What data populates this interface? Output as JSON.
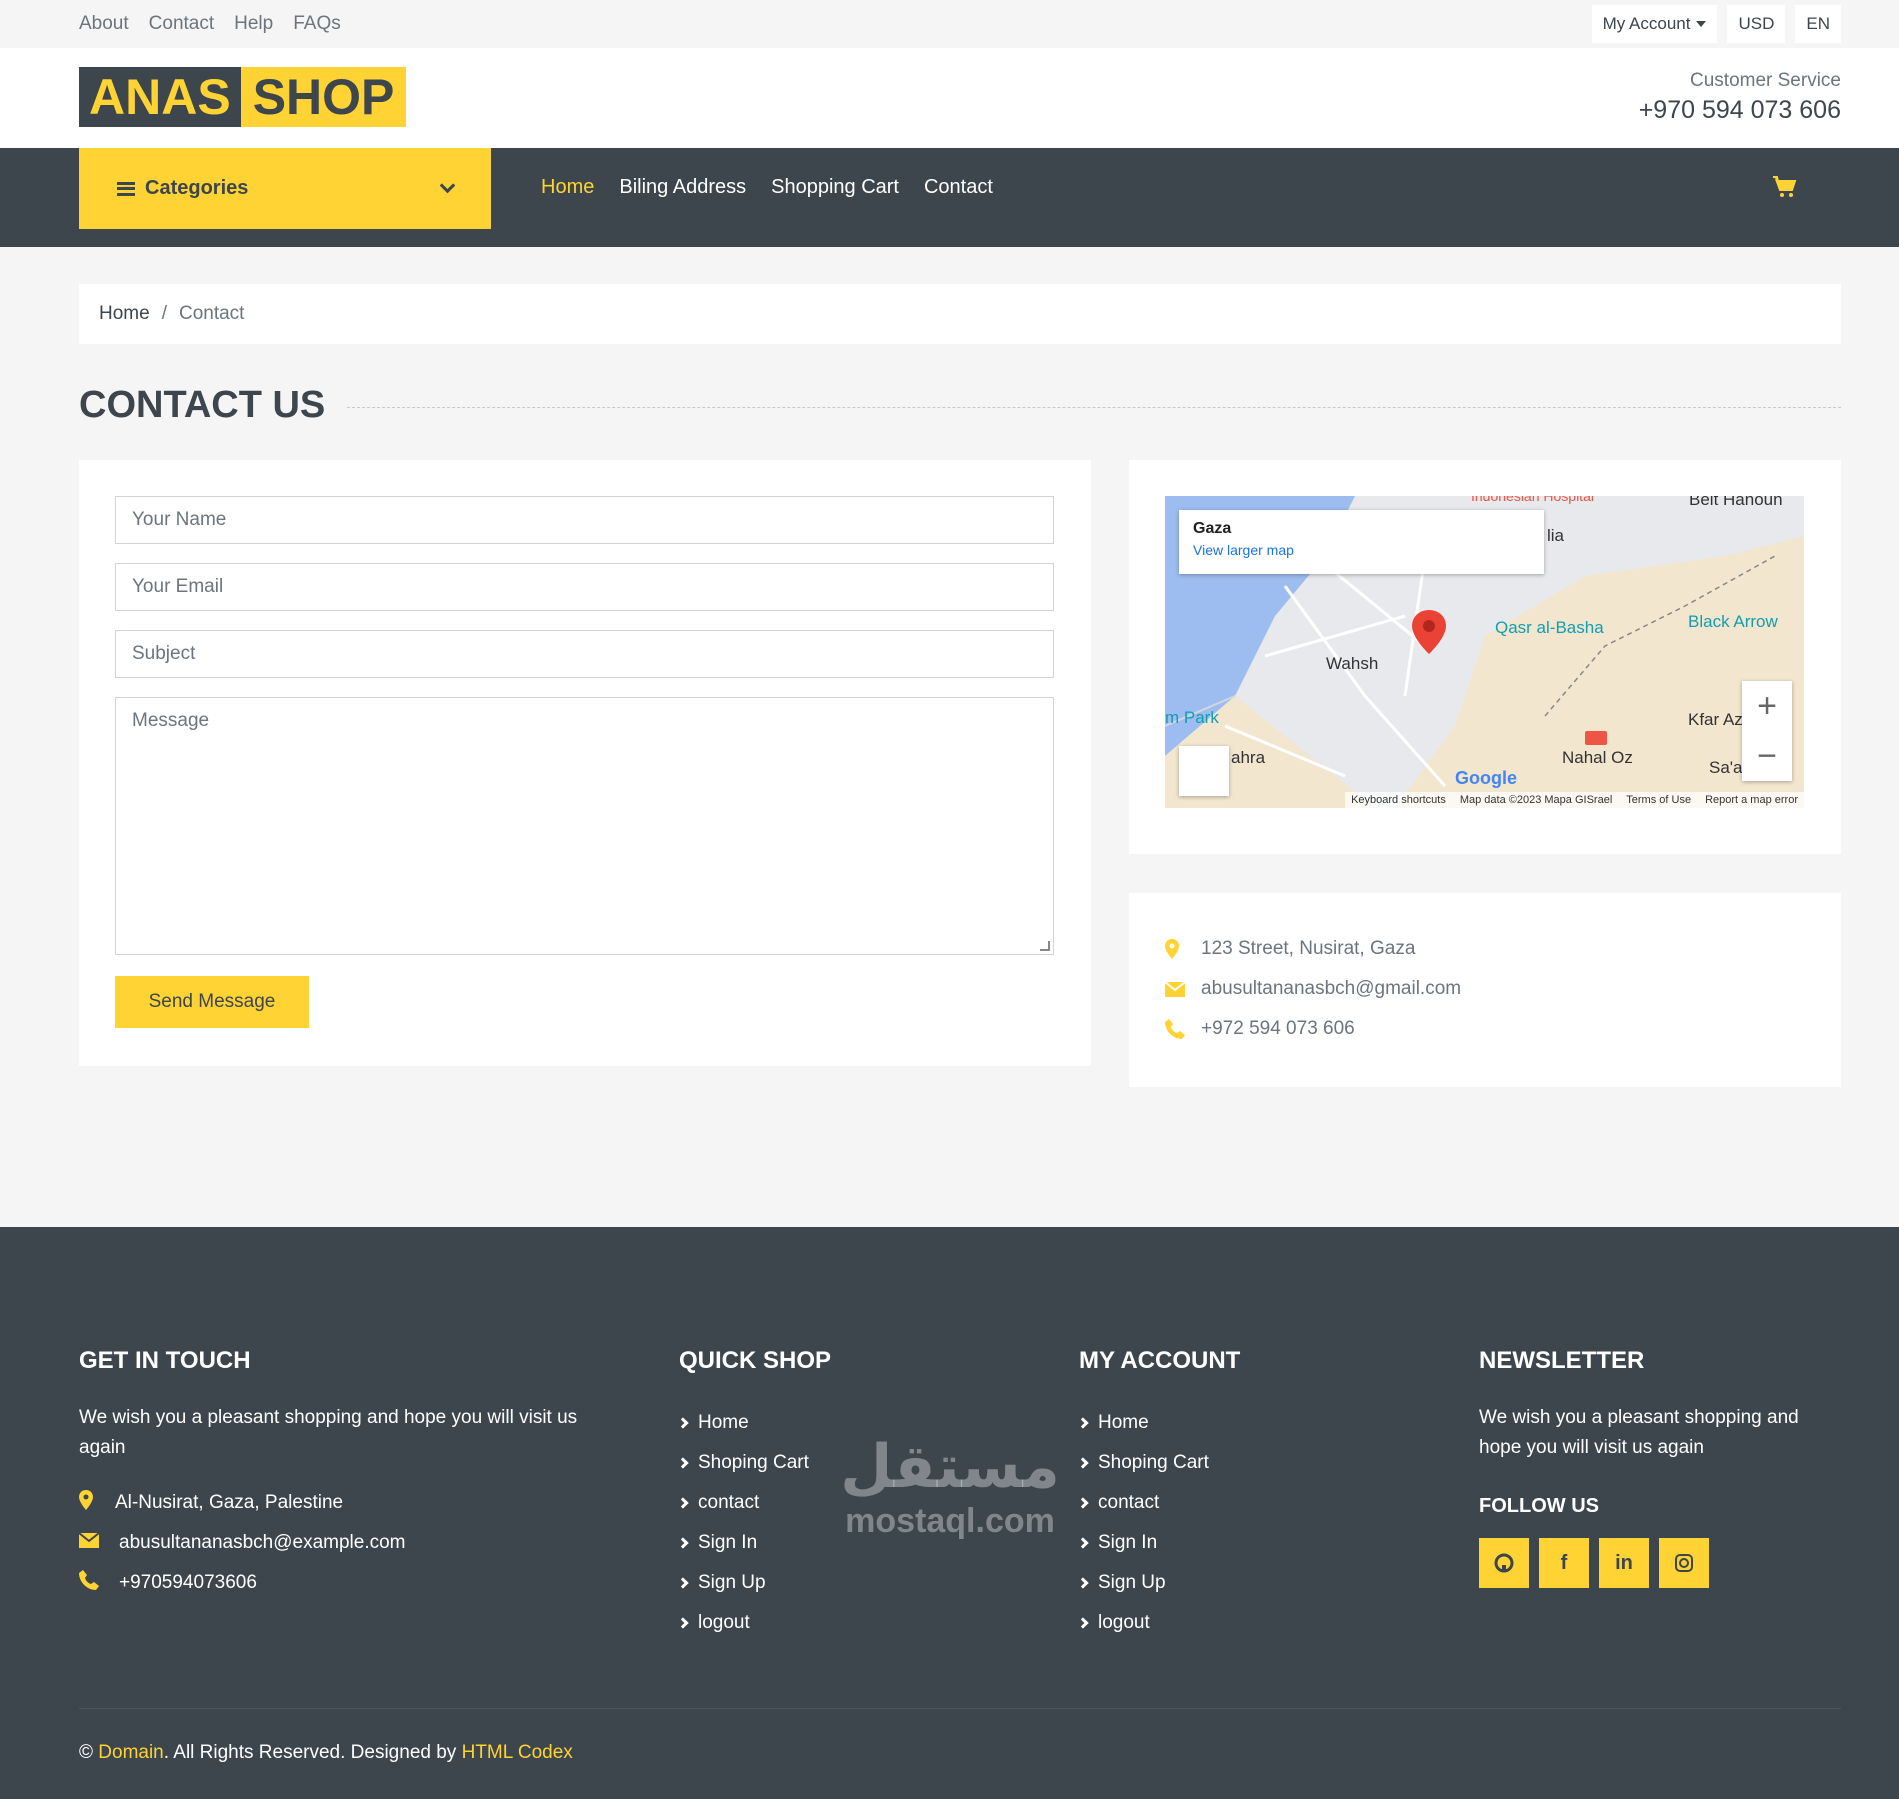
{
  "topbar": {
    "links": [
      "About",
      "Contact",
      "Help",
      "FAQs"
    ],
    "my_account": "My Account",
    "currency": "USD",
    "language": "EN"
  },
  "header": {
    "logo_part1": "ANAS",
    "logo_part2": "SHOP",
    "cs_label": "Customer Service",
    "cs_phone": "+970 594 073 606"
  },
  "navbar": {
    "categories": "Categories",
    "links": [
      "Home",
      "Biling Address",
      "Shopping Cart",
      "Contact"
    ]
  },
  "breadcrumb": {
    "home": "Home",
    "sep": "/",
    "current": "Contact"
  },
  "page_title": "CONTACT US",
  "form": {
    "name_placeholder": "Your Name",
    "email_placeholder": "Your Email",
    "subject_placeholder": "Subject",
    "message_placeholder": "Message",
    "send_label": "Send Message"
  },
  "map": {
    "place": "Gaza",
    "view_larger": "View larger map",
    "labels": [
      "Wahsh",
      "Qasr al-Basha",
      "Black Arrow",
      "m Park",
      "Kfar Az",
      "Nahal Oz",
      "Sa'ad",
      "ahra",
      "lia",
      "Beit Hanoun",
      "Indonesian Hospital"
    ],
    "attribution": [
      "Keyboard shortcuts",
      "Map data ©2023 Mapa GISrael",
      "Terms of Use",
      "Report a map error"
    ]
  },
  "contact_info": {
    "address": "123 Street, Nusirat, Gaza",
    "email": "abusultananasbch@gmail.com",
    "phone": "+972 594 073 606"
  },
  "footer": {
    "get_in_touch": {
      "title": "GET IN TOUCH",
      "text": "We wish you a pleasant shopping and hope you will visit us again",
      "address": "Al-Nusirat, Gaza, Palestine",
      "email": "abusultananasbch@example.com",
      "phone": "+970594073606"
    },
    "quick_shop": {
      "title": "QUICK SHOP",
      "links": [
        "Home",
        "Shoping Cart",
        "contact",
        "Sign In",
        "Sign Up",
        "logout"
      ]
    },
    "my_account": {
      "title": "MY ACCOUNT",
      "links": [
        "Home",
        "Shoping Cart",
        "contact",
        "Sign In",
        "Sign Up",
        "logout"
      ]
    },
    "newsletter": {
      "title": "NEWSLETTER",
      "text": "We wish you a pleasant shopping and hope you will visit us again",
      "follow": "FOLLOW US"
    },
    "copyright": {
      "symbol": "©",
      "domain": "Domain",
      "middle": ". All Rights Reserved. Designed by",
      "designer": "HTML Codex"
    }
  },
  "watermark": {
    "arabic": "مستقل",
    "latin": "mostaql.com"
  },
  "colors": {
    "accent": "#ffd333",
    "dark": "#3d464d",
    "muted": "#6c757d"
  }
}
